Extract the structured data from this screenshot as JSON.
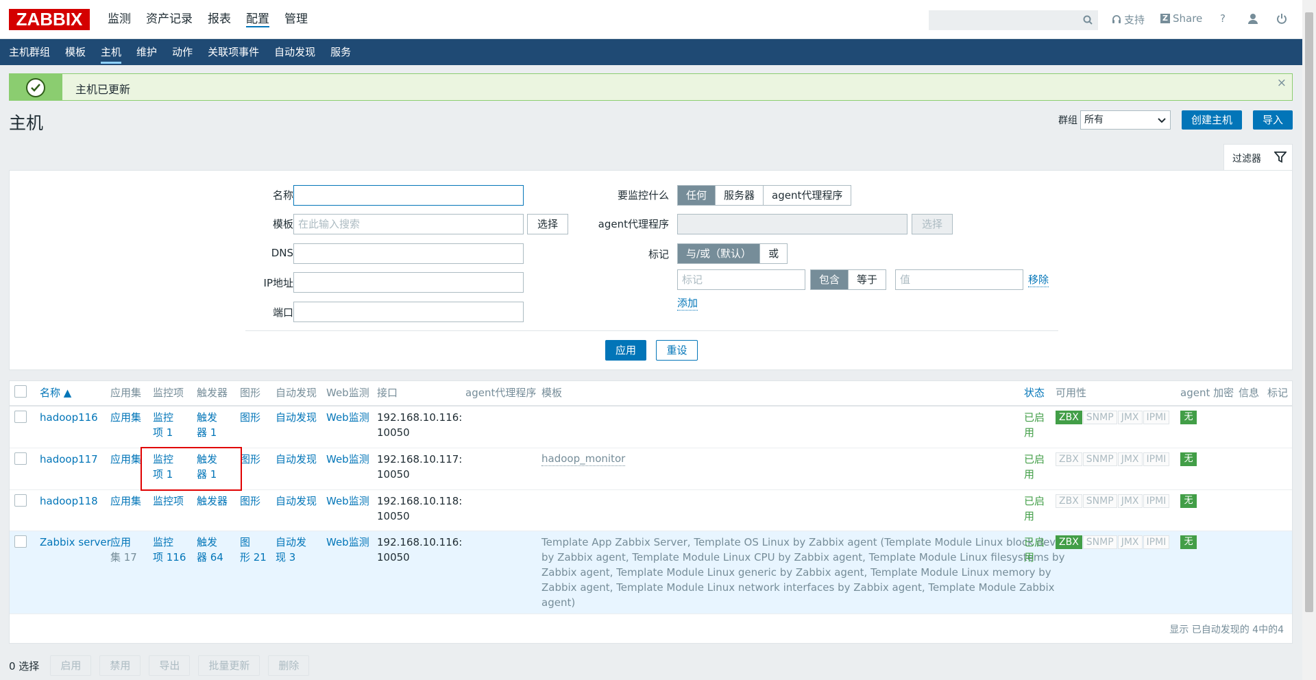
{
  "app": {
    "logo": "ZABBIX"
  },
  "main_menu": [
    {
      "label": "监测",
      "selected": false
    },
    {
      "label": "资产记录",
      "selected": false
    },
    {
      "label": "报表",
      "selected": false
    },
    {
      "label": "配置",
      "selected": true
    },
    {
      "label": "管理",
      "selected": false
    }
  ],
  "top_links": {
    "support": "支持",
    "share": "Share",
    "help": "?"
  },
  "sub_menu": [
    {
      "label": "主机群组",
      "selected": false
    },
    {
      "label": "模板",
      "selected": false
    },
    {
      "label": "主机",
      "selected": true
    },
    {
      "label": "维护",
      "selected": false
    },
    {
      "label": "动作",
      "selected": false
    },
    {
      "label": "关联项事件",
      "selected": false
    },
    {
      "label": "自动发现",
      "selected": false
    },
    {
      "label": "服务",
      "selected": false
    }
  ],
  "message": {
    "text": "主机已更新",
    "close": "×"
  },
  "page": {
    "title": "主机",
    "group_label": "群组",
    "group_value": "所有",
    "create_button": "创建主机",
    "import_button": "导入"
  },
  "filter": {
    "tab_label": "过滤器",
    "name_label": "名称",
    "name_value": "",
    "template_label": "模板",
    "template_placeholder": "在此输入搜索",
    "template_select": "选择",
    "dns_label": "DNS",
    "ip_label": "IP地址",
    "port_label": "端口",
    "monitor_label": "要监控什么",
    "monitor_options": [
      {
        "label": "任何",
        "selected": true
      },
      {
        "label": "服务器",
        "selected": false
      },
      {
        "label": "agent代理程序",
        "selected": false
      }
    ],
    "proxy_label": "agent代理程序",
    "proxy_select": "选择",
    "tags_label": "标记",
    "tags_mode": [
      {
        "label": "与/或（默认）",
        "selected": true
      },
      {
        "label": "或",
        "selected": false
      }
    ],
    "tag_placeholder": "标记",
    "tag_ops": [
      {
        "label": "包含",
        "selected": true
      },
      {
        "label": "等于",
        "selected": false
      }
    ],
    "value_placeholder": "值",
    "remove": "移除",
    "add": "添加",
    "apply": "应用",
    "reset": "重设"
  },
  "table": {
    "headers": {
      "name": "名称 ▲",
      "apps": "应用集",
      "items": "监控项",
      "triggers": "触发器",
      "graphs": "图形",
      "discovery": "自动发现",
      "web": "Web监测",
      "interface": "接口",
      "proxy": "agent代理程序",
      "templates": "模板",
      "status": "状态",
      "availability": "可用性",
      "encryption": "agent 加密",
      "info": "信息",
      "tags": "标记"
    },
    "rows": [
      {
        "name": "hadoop116",
        "apps_1": "应用集",
        "apps_2": "",
        "items_1": "监控",
        "items_2": "项 1",
        "triggers_1": "触发",
        "triggers_2": "器 1",
        "graphs_1": "图形",
        "graphs_2": "",
        "disc_1": "自动发现",
        "disc_2": "",
        "web": "Web监测",
        "iface_1": "192.168.10.116:",
        "iface_2": "10050",
        "templates": "",
        "status_1": "已启",
        "status_2": "用",
        "zbx_on": true,
        "enc": "无"
      },
      {
        "name": "hadoop117",
        "apps_1": "应用集",
        "apps_2": "",
        "items_1": "监控",
        "items_2": "项 1",
        "triggers_1": "触发",
        "triggers_2": "器 1",
        "graphs_1": "图形",
        "graphs_2": "",
        "disc_1": "自动发现",
        "disc_2": "",
        "web": "Web监测",
        "iface_1": "192.168.10.117:",
        "iface_2": "10050",
        "templates": "hadoop_monitor",
        "status_1": "已启",
        "status_2": "用",
        "zbx_on": false,
        "enc": "无"
      },
      {
        "name": "hadoop118",
        "apps_1": "应用集",
        "apps_2": "",
        "items_1": "监控项",
        "items_2": "",
        "triggers_1": "触发器",
        "triggers_2": "",
        "graphs_1": "图形",
        "graphs_2": "",
        "disc_1": "自动发现",
        "disc_2": "",
        "web": "Web监测",
        "iface_1": "192.168.10.118:",
        "iface_2": "10050",
        "templates": "",
        "status_1": "已启",
        "status_2": "用",
        "zbx_on": false,
        "enc": "无"
      },
      {
        "name": "Zabbix server",
        "apps_1": "应用",
        "apps_2": "集 17",
        "items_1": "监控",
        "items_2": "项 116",
        "triggers_1": "触发",
        "triggers_2": "器 64",
        "graphs_1": "图",
        "graphs_2": "形 21",
        "disc_1": "自动发",
        "disc_2": "现 3",
        "web": "Web监测",
        "iface_1": "192.168.10.116:",
        "iface_2": "10050",
        "templates_lines": [
          "Template App Zabbix Server, Template OS Linux by Zabbix agent (Template Module Linux block devices",
          "by Zabbix agent, Template Module Linux CPU by Zabbix agent, Template Module Linux filesystems by",
          "Zabbix agent, Template Module Linux generic by Zabbix agent, Template Module Linux memory by",
          "Zabbix agent, Template Module Linux network interfaces by Zabbix agent, Template Module Zabbix",
          "agent)"
        ],
        "status_1": "已启",
        "status_2": "用",
        "zbx_on": true,
        "enc": "无"
      }
    ],
    "avail_labels": [
      "ZBX",
      "SNMP",
      "JMX",
      "IPMI"
    ],
    "summary": "显示 已自动发现的 4中的4"
  },
  "footer": {
    "selected": "0 选择",
    "buttons": [
      "启用",
      "禁用",
      "导出",
      "批量更新",
      "删除"
    ]
  },
  "colors": {
    "header_blue": "#1f4a74",
    "accent": "#0275b8",
    "ok_green": "#429e47",
    "brand_red": "#d40000"
  }
}
